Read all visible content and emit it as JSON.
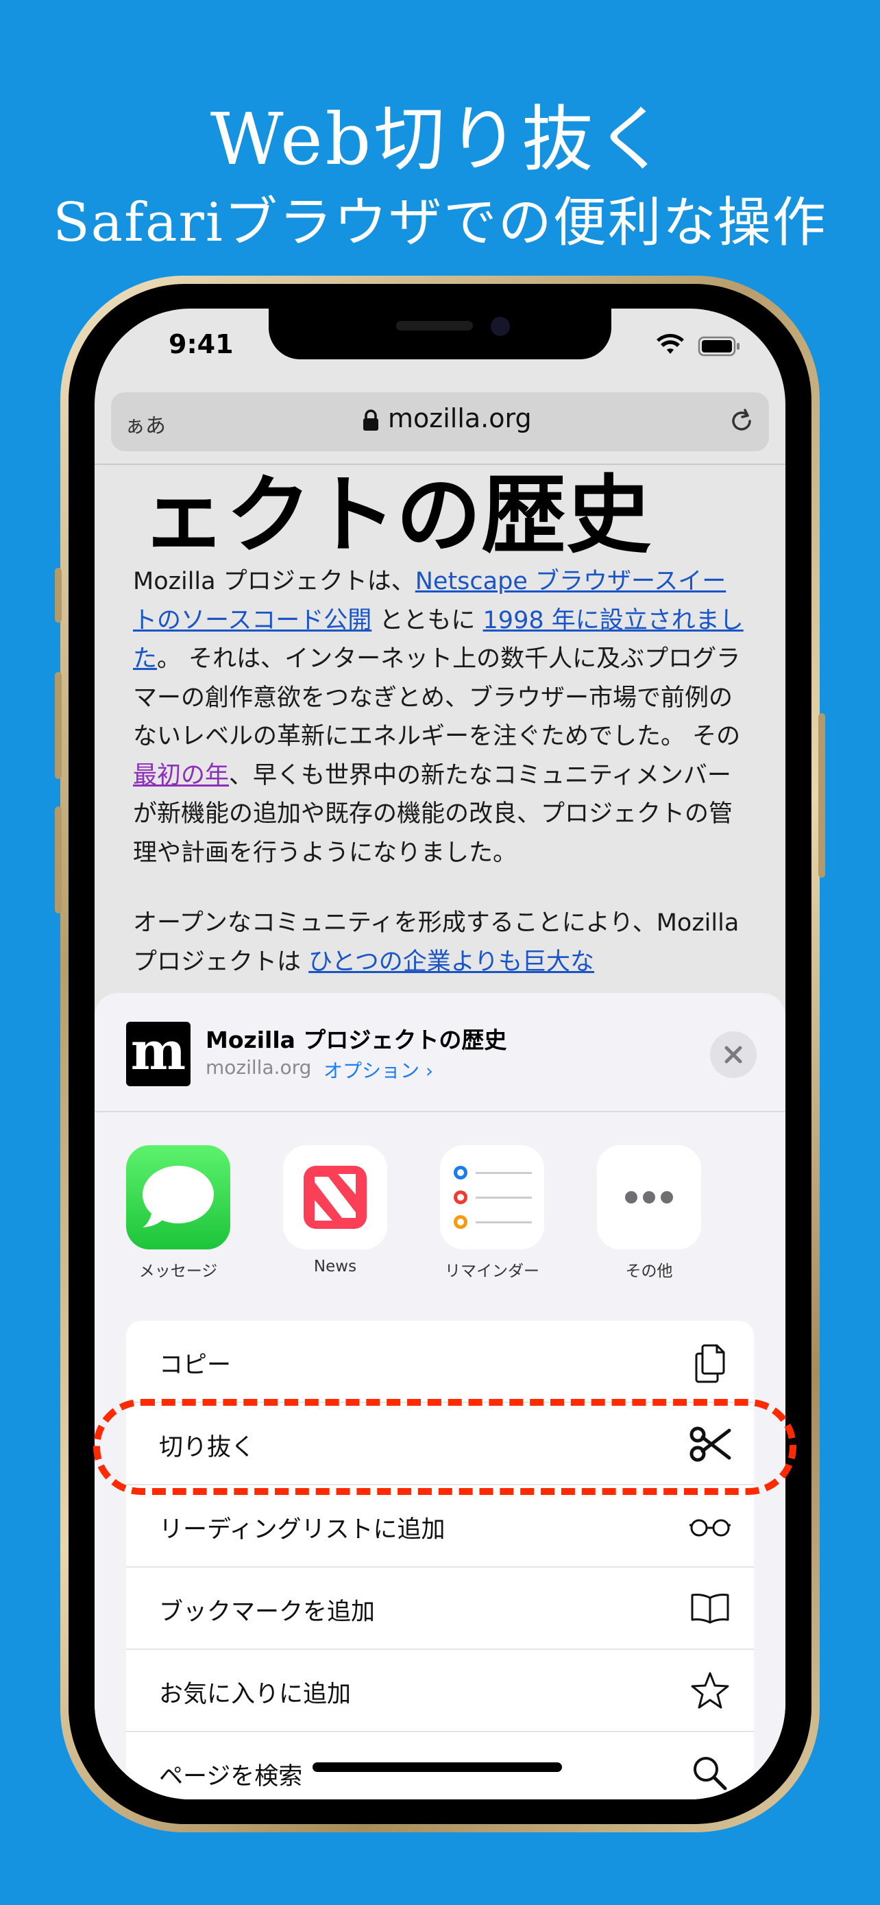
{
  "promo": {
    "title": "Web切り抜く",
    "subtitle": "Safariブラウザでの便利な操作"
  },
  "status_bar": {
    "time": "9:41"
  },
  "address_bar": {
    "text_size_label": "ぁあ",
    "domain": "mozilla.org"
  },
  "page": {
    "heading": "ェクトの歴史",
    "para1_t1": "Mozilla プロジェクトは、",
    "para1_link1": "Netscape ブラウザースイートのソースコード公開",
    "para1_t2": " とともに ",
    "para1_link2": "1998 年に設立されました",
    "para1_t3": "。 それは、インターネット上の数千人に及ぶプログラマーの創作意欲をつなぎとめ、ブラウザー市場で前例のないレベルの革新にエネルギーを注ぐためでした。 その ",
    "para1_link3": "最初の年",
    "para1_t4": "、早くも世界中の新たなコミュニティメンバーが新機能の追加や既存の機能の改良、プロジェクトの管理や計画を行うようになりました。",
    "para2_t1": "オープンなコミュニティを形成することにより、Mozilla プロジェクトは ",
    "para2_link1": "ひとつの企業よりも巨大な"
  },
  "share_sheet": {
    "logo_letter": "m",
    "title": "Mozilla プロジェクトの歴史",
    "domain": "mozilla.org",
    "options_label": "オプション ›",
    "apps": [
      {
        "label": "メッセージ",
        "icon": "messages-icon"
      },
      {
        "label": "News",
        "icon": "news-icon"
      },
      {
        "label": "リマインダー",
        "icon": "reminders-icon"
      },
      {
        "label": "その他",
        "icon": "more-icon"
      }
    ],
    "actions": [
      {
        "label": "コピー",
        "icon": "copy-icon"
      },
      {
        "label": "切り抜く",
        "icon": "scissors-icon"
      },
      {
        "label": "リーディングリストに追加",
        "icon": "glasses-icon"
      },
      {
        "label": "ブックマークを追加",
        "icon": "book-icon"
      },
      {
        "label": "お気に入りに追加",
        "icon": "star-icon"
      },
      {
        "label": "ページを検索",
        "icon": "search-icon"
      }
    ]
  },
  "colors": {
    "background": "#1592e0",
    "highlight": "#ff2a00",
    "link": "#1a55c8",
    "visited_link": "#8d2fbb",
    "options_link": "#1a7cf5"
  }
}
